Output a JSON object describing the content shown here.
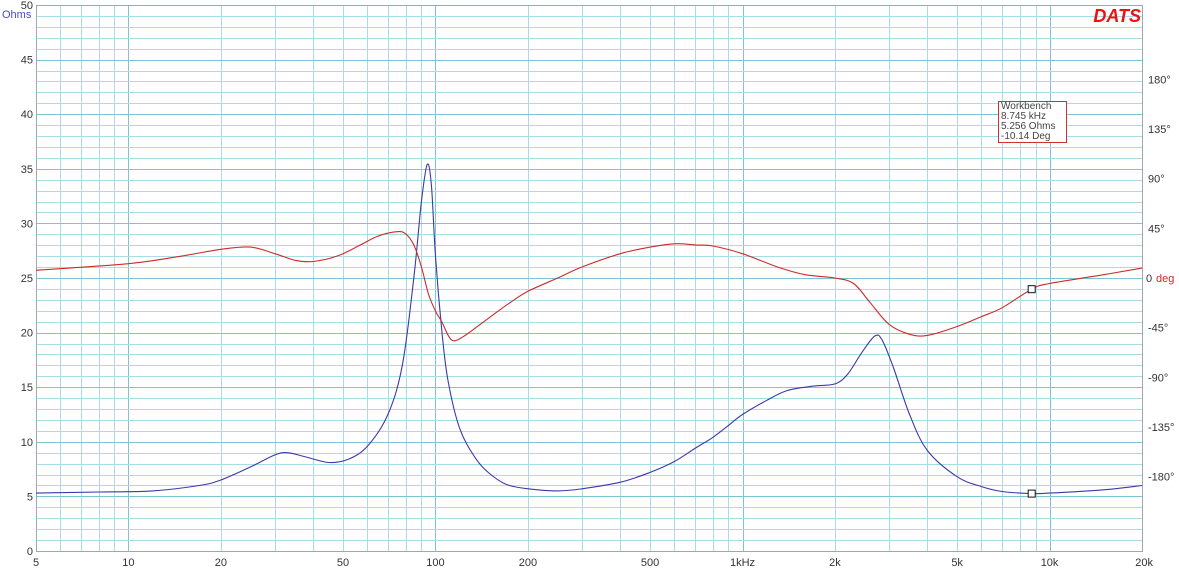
{
  "chart_data": {
    "type": "line",
    "brand": "DATS",
    "x_scale": "log",
    "xlim": [
      5,
      20000
    ],
    "x_ticks": [
      5,
      10,
      20,
      50,
      100,
      200,
      500,
      1000,
      2000,
      5000,
      10000,
      20000
    ],
    "x_tick_labels": [
      "5",
      "10",
      "20",
      "50",
      "100",
      "200",
      "500",
      "1kHz",
      "2k",
      "5k",
      "10k",
      "20k"
    ],
    "y_left": {
      "label": "Ohms",
      "ylim": [
        0,
        50
      ],
      "ticks": [
        0,
        5,
        10,
        15,
        20,
        25,
        30,
        35,
        40,
        45,
        50
      ],
      "tick_labels": [
        "0",
        "5",
        "10",
        "15",
        "20",
        "25",
        "30",
        "35",
        "40",
        "45",
        "50"
      ]
    },
    "y_right": {
      "label": "deg",
      "ylim": [
        -247.5,
        247.5
      ],
      "ticks": [
        -180,
        -135,
        -90,
        -45,
        0,
        45,
        90,
        135,
        180
      ],
      "tick_labels": [
        "-180°",
        "-135°",
        "-90°",
        "-45°",
        "0",
        "45°",
        "90°",
        "135°",
        "180°"
      ]
    },
    "grid": true,
    "colors": {
      "impedance": "#3a3aa8",
      "phase": "#cc2b2b",
      "grid": "#a8dde6",
      "grid_major": "#7cc5d3"
    },
    "series": [
      {
        "name": "Ohms",
        "axis": "left",
        "points": [
          [
            5,
            5.3
          ],
          [
            8,
            5.4
          ],
          [
            12,
            5.5
          ],
          [
            17,
            6
          ],
          [
            20,
            6.5
          ],
          [
            25,
            7.7
          ],
          [
            30,
            8.8
          ],
          [
            33,
            9
          ],
          [
            38,
            8.6
          ],
          [
            45,
            8.1
          ],
          [
            52,
            8.4
          ],
          [
            60,
            9.6
          ],
          [
            70,
            12.5
          ],
          [
            78,
            17
          ],
          [
            85,
            25
          ],
          [
            90,
            32
          ],
          [
            94,
            35.4
          ],
          [
            97,
            33.5
          ],
          [
            100,
            27
          ],
          [
            105,
            20
          ],
          [
            110,
            15.5
          ],
          [
            120,
            11.2
          ],
          [
            135,
            8.5
          ],
          [
            150,
            7.1
          ],
          [
            170,
            6.1
          ],
          [
            200,
            5.7
          ],
          [
            250,
            5.5
          ],
          [
            300,
            5.7
          ],
          [
            400,
            6.3
          ],
          [
            500,
            7.2
          ],
          [
            600,
            8.2
          ],
          [
            700,
            9.4
          ],
          [
            800,
            10.4
          ],
          [
            900,
            11.5
          ],
          [
            1000,
            12.5
          ],
          [
            1200,
            13.8
          ],
          [
            1400,
            14.7
          ],
          [
            1700,
            15.1
          ],
          [
            2000,
            15.3
          ],
          [
            2200,
            16.2
          ],
          [
            2450,
            18.2
          ],
          [
            2700,
            19.7
          ],
          [
            2850,
            19.3
          ],
          [
            3100,
            16.8
          ],
          [
            3500,
            12.5
          ],
          [
            4000,
            9.2
          ],
          [
            5000,
            6.8
          ],
          [
            6000,
            5.9
          ],
          [
            7000,
            5.45
          ],
          [
            8745,
            5.256
          ],
          [
            10000,
            5.3
          ],
          [
            15000,
            5.6
          ],
          [
            20000,
            6
          ]
        ]
      },
      {
        "name": "deg",
        "axis": "right",
        "points": [
          [
            5,
            7
          ],
          [
            10,
            13
          ],
          [
            15,
            20
          ],
          [
            20,
            26
          ],
          [
            25,
            28
          ],
          [
            30,
            22
          ],
          [
            35,
            16
          ],
          [
            40,
            15
          ],
          [
            48,
            20
          ],
          [
            57,
            30
          ],
          [
            65,
            38
          ],
          [
            75,
            42
          ],
          [
            80,
            40
          ],
          [
            85,
            30
          ],
          [
            90,
            10
          ],
          [
            95,
            -15
          ],
          [
            100,
            -30
          ],
          [
            105,
            -40
          ],
          [
            110,
            -52
          ],
          [
            115,
            -57
          ],
          [
            125,
            -52
          ],
          [
            140,
            -42
          ],
          [
            160,
            -30
          ],
          [
            180,
            -20
          ],
          [
            200,
            -12
          ],
          [
            250,
            0
          ],
          [
            300,
            10
          ],
          [
            400,
            22
          ],
          [
            500,
            28
          ],
          [
            600,
            31
          ],
          [
            700,
            30
          ],
          [
            800,
            29
          ],
          [
            1000,
            22
          ],
          [
            1300,
            10
          ],
          [
            1600,
            3
          ],
          [
            2000,
            0
          ],
          [
            2300,
            -5
          ],
          [
            2600,
            -22
          ],
          [
            3000,
            -42
          ],
          [
            3500,
            -51
          ],
          [
            4000,
            -52
          ],
          [
            5000,
            -44
          ],
          [
            6000,
            -35
          ],
          [
            7000,
            -27
          ],
          [
            8745,
            -10.14
          ],
          [
            10000,
            -5
          ],
          [
            15000,
            3
          ],
          [
            20000,
            9
          ]
        ]
      }
    ],
    "markers": [
      {
        "x": 8745,
        "axis": "left",
        "y": 5.256
      },
      {
        "x": 8745,
        "axis": "right",
        "y": -10.14
      }
    ]
  },
  "cursor_readout": {
    "title": "Workbench",
    "frequency": "8.745 kHz",
    "impedance": "5.256 Ohms",
    "phase": "-10.14 Deg"
  }
}
